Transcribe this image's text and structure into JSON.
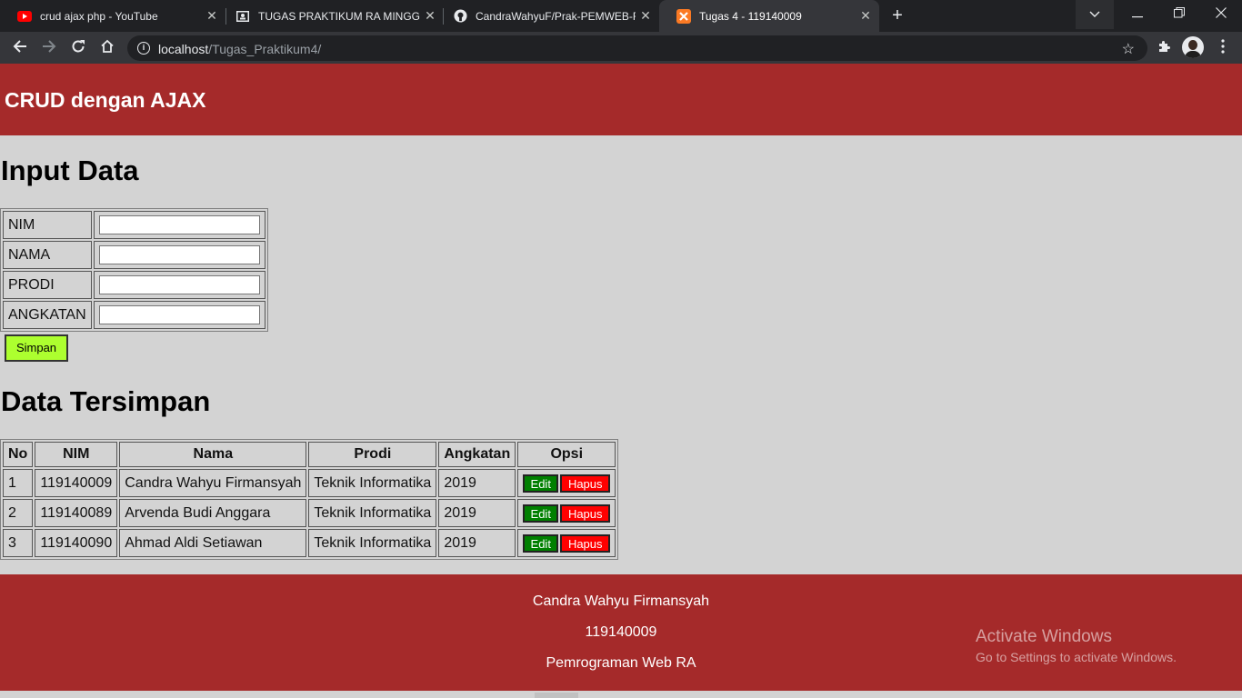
{
  "browser": {
    "tabs": [
      {
        "title": "crud ajax php - YouTube",
        "icon": "youtube-icon",
        "active": false
      },
      {
        "title": "TUGAS PRAKTIKUM RA MINGGU",
        "icon": "classroom-icon",
        "active": false
      },
      {
        "title": "CandraWahyuF/Prak-PEMWEB-R",
        "icon": "github-icon",
        "active": false
      },
      {
        "title": "Tugas 4 - 119140009",
        "icon": "xampp-icon",
        "active": true
      }
    ],
    "new_tab_label": "+",
    "url_host": "localhost",
    "url_path": "/Tugas_Praktikum4/"
  },
  "header": {
    "title": "CRUD dengan AJAX"
  },
  "input_section": {
    "title": "Input Data",
    "fields": [
      {
        "label": "NIM",
        "value": ""
      },
      {
        "label": "NAMA",
        "value": ""
      },
      {
        "label": "PRODI",
        "value": ""
      },
      {
        "label": "ANGKATAN",
        "value": ""
      }
    ],
    "save_label": "Simpan"
  },
  "data_section": {
    "title": "Data Tersimpan",
    "columns": [
      "No",
      "NIM",
      "Nama",
      "Prodi",
      "Angkatan",
      "Opsi"
    ],
    "rows": [
      {
        "no": "1",
        "nim": "119140009",
        "nama": "Candra Wahyu Firmansyah",
        "prodi": "Teknik Informatika",
        "angkatan": "2019"
      },
      {
        "no": "2",
        "nim": "119140089",
        "nama": "Arvenda Budi Anggara",
        "prodi": "Teknik Informatika",
        "angkatan": "2019"
      },
      {
        "no": "3",
        "nim": "119140090",
        "nama": "Ahmad Aldi Setiawan",
        "prodi": "Teknik Informatika",
        "angkatan": "2019"
      }
    ],
    "edit_label": "Edit",
    "delete_label": "Hapus"
  },
  "footer": {
    "name": "Candra Wahyu Firmansyah",
    "nim": "119140009",
    "course": "Pemrograman Web RA"
  },
  "watermark": {
    "line1": "Activate Windows",
    "line2": "Go to Settings to activate Windows."
  },
  "colors": {
    "header_bg": "#a52a2a",
    "page_bg": "#d3d3d3",
    "save_button": "#adff2f",
    "edit_button": "#008000",
    "delete_button": "#ff0000"
  }
}
